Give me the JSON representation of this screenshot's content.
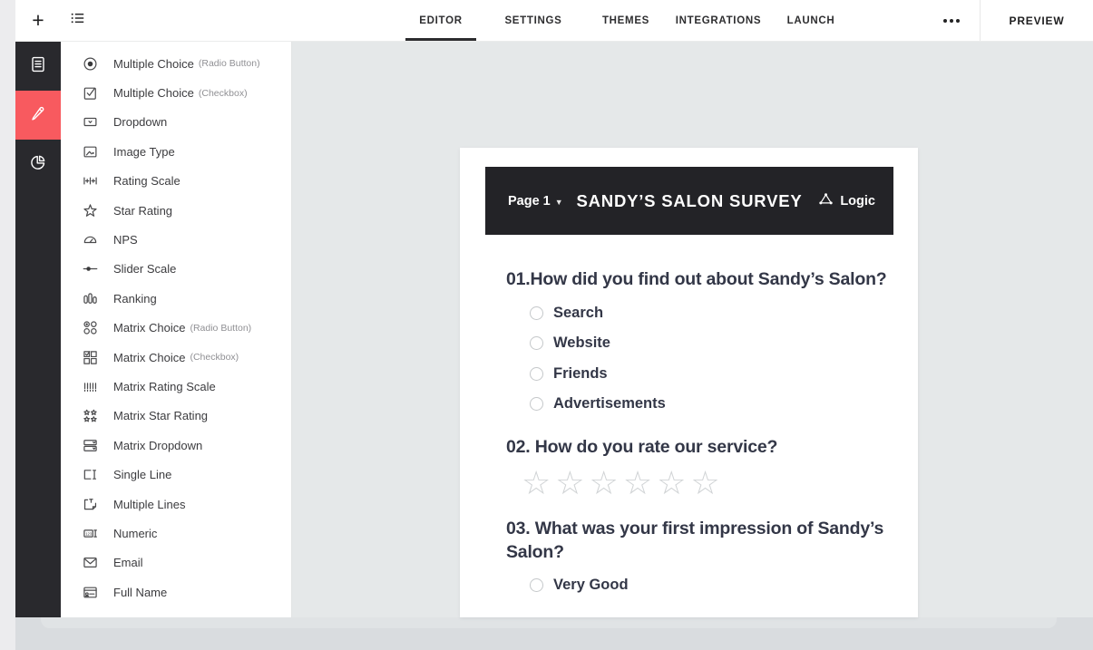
{
  "colors": {
    "accent": "#f85a5f",
    "sidebar": "#29292d",
    "header": "#232327",
    "canvas": "#e5e8e9"
  },
  "topbar": {
    "plus_icon": "plus",
    "list_icon": "question-list",
    "more_icon": "more-dots",
    "preview_label": "PREVIEW",
    "tabs": [
      {
        "label": "EDITOR",
        "active": true
      },
      {
        "label": "SETTINGS",
        "active": false
      },
      {
        "label": "THEMES",
        "active": false
      },
      {
        "label": "INTEGRATIONS",
        "active": false
      },
      {
        "label": "LAUNCH",
        "active": false
      }
    ]
  },
  "sidebar": {
    "items": [
      {
        "icon": "document",
        "active": false
      },
      {
        "icon": "pencil",
        "active": true
      },
      {
        "icon": "pie-chart",
        "active": false
      }
    ]
  },
  "question_types": [
    {
      "label": "Multiple Choice",
      "sublabel": "(Radio Button)",
      "icon": "radio"
    },
    {
      "label": "Multiple Choice",
      "sublabel": "(Checkbox)",
      "icon": "checkbox"
    },
    {
      "label": "Dropdown",
      "icon": "dropdown"
    },
    {
      "label": "Image Type",
      "icon": "image"
    },
    {
      "label": "Rating Scale",
      "icon": "rating-scale"
    },
    {
      "label": "Star Rating",
      "icon": "star"
    },
    {
      "label": "NPS",
      "icon": "nps"
    },
    {
      "label": "Slider Scale",
      "icon": "slider"
    },
    {
      "label": "Ranking",
      "icon": "ranking"
    },
    {
      "label": "Matrix Choice",
      "sublabel": "(Radio Button)",
      "icon": "matrix-radio"
    },
    {
      "label": "Matrix Choice",
      "sublabel": "(Checkbox)",
      "icon": "matrix-checkbox"
    },
    {
      "label": "Matrix Rating Scale",
      "icon": "matrix-rating"
    },
    {
      "label": "Matrix Star Rating",
      "icon": "matrix-star"
    },
    {
      "label": "Matrix Dropdown",
      "icon": "matrix-dropdown"
    },
    {
      "label": "Single Line",
      "icon": "single-line"
    },
    {
      "label": "Multiple Lines",
      "icon": "multiple-lines"
    },
    {
      "label": "Numeric",
      "icon": "numeric"
    },
    {
      "label": "Email",
      "icon": "email"
    },
    {
      "label": "Full Name",
      "icon": "full-name"
    }
  ],
  "survey": {
    "page_label": "Page 1",
    "title": "SANDY’S SALON SURVEY",
    "logic_label": "Logic",
    "questions": [
      {
        "title": "01.How did you find out about Sandy’s Salon?",
        "type": "radio",
        "options": [
          "Search",
          "Website",
          "Friends",
          "Advertisements"
        ]
      },
      {
        "title": "02. How do you rate our service?",
        "type": "stars",
        "stars": 6,
        "options": []
      },
      {
        "title": "03. What was your first impression of Sandy’s Salon?",
        "type": "radio",
        "options": [
          "Very Good"
        ]
      }
    ]
  }
}
